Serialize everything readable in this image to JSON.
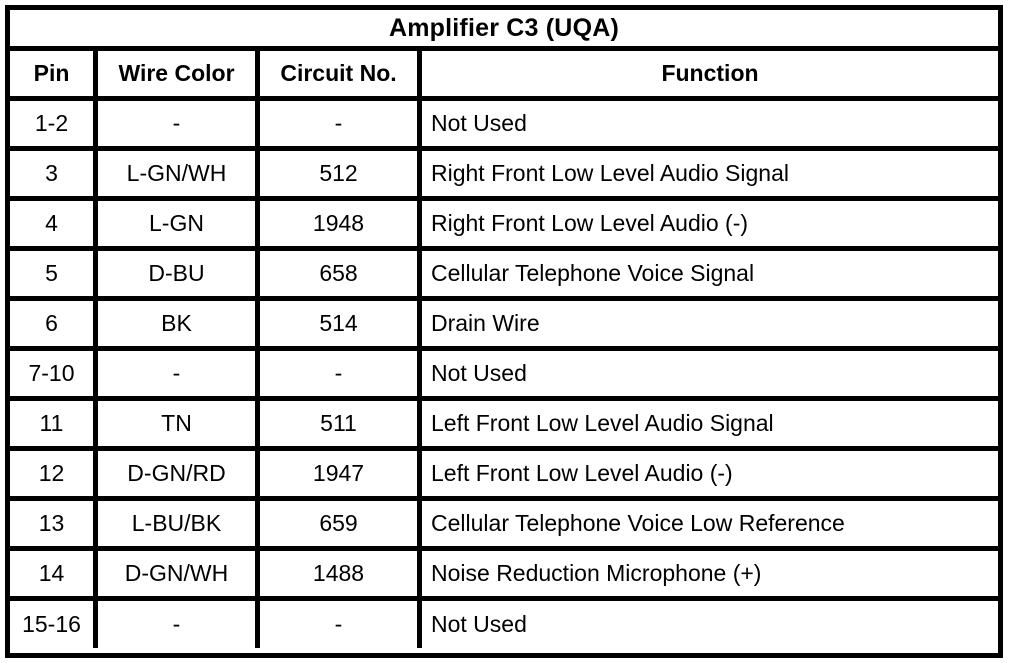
{
  "table": {
    "title": "Amplifier C3 (UQA)",
    "columns": [
      {
        "key": "pin",
        "label": "Pin"
      },
      {
        "key": "color",
        "label": "Wire Color"
      },
      {
        "key": "circuit",
        "label": "Circuit No."
      },
      {
        "key": "function",
        "label": "Function"
      }
    ],
    "rows": [
      {
        "pin": "1-2",
        "color": "-",
        "circuit": "-",
        "function": "Not Used"
      },
      {
        "pin": "3",
        "color": "L-GN/WH",
        "circuit": "512",
        "function": "Right Front Low Level Audio Signal"
      },
      {
        "pin": "4",
        "color": "L-GN",
        "circuit": "1948",
        "function": "Right Front Low Level Audio (-)"
      },
      {
        "pin": "5",
        "color": "D-BU",
        "circuit": "658",
        "function": "Cellular Telephone Voice Signal"
      },
      {
        "pin": "6",
        "color": "BK",
        "circuit": "514",
        "function": "Drain Wire"
      },
      {
        "pin": "7-10",
        "color": "-",
        "circuit": "-",
        "function": "Not Used"
      },
      {
        "pin": "11",
        "color": "TN",
        "circuit": "511",
        "function": "Left Front Low Level Audio Signal"
      },
      {
        "pin": "12",
        "color": "D-GN/RD",
        "circuit": "1947",
        "function": "Left Front Low Level Audio (-)"
      },
      {
        "pin": "13",
        "color": "L-BU/BK",
        "circuit": "659",
        "function": "Cellular Telephone Voice Low Reference"
      },
      {
        "pin": "14",
        "color": "D-GN/WH",
        "circuit": "1488",
        "function": "Noise Reduction Microphone (+)"
      },
      {
        "pin": "15-16",
        "color": "-",
        "circuit": "-",
        "function": "Not Used"
      }
    ],
    "style": {
      "border_color": "#000000",
      "background_color": "#ffffff",
      "text_color": "#000000"
    }
  }
}
